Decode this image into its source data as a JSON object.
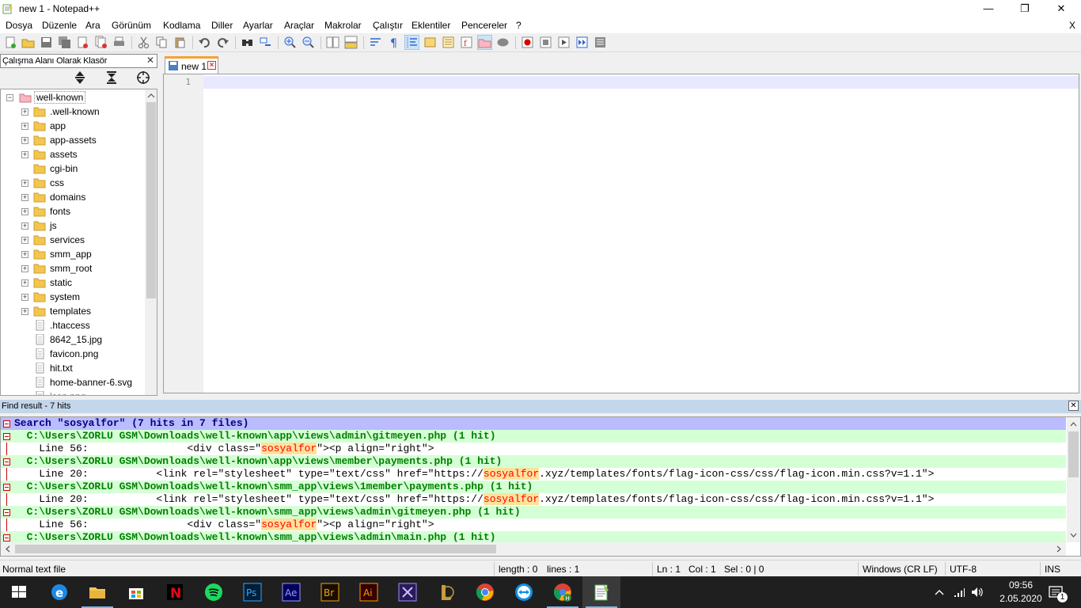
{
  "window": {
    "title": "new 1 - Notepad++",
    "minimize": "—",
    "restore": "❐",
    "close": "✕"
  },
  "menu": [
    {
      "label": "Dosya"
    },
    {
      "label": "Düzenle"
    },
    {
      "label": "Ara"
    },
    {
      "label": "Görünüm"
    },
    {
      "label": "Kodlama"
    },
    {
      "label": "Diller"
    },
    {
      "label": "Ayarlar"
    },
    {
      "label": "Araçlar"
    },
    {
      "label": "Makrolar"
    },
    {
      "label": "Çalıştır"
    },
    {
      "label": "Eklentiler"
    },
    {
      "label": "Pencereler"
    },
    {
      "label": "?"
    }
  ],
  "menu_close": "X",
  "workspace": {
    "title": "Çalışma Alanı Olarak Klasör",
    "close": "✕",
    "root": "well-known",
    "items": [
      {
        "label": ".well-known",
        "type": "folder",
        "expandable": true
      },
      {
        "label": "app",
        "type": "folder",
        "expandable": true
      },
      {
        "label": "app-assets",
        "type": "folder",
        "expandable": true
      },
      {
        "label": "assets",
        "type": "folder",
        "expandable": true
      },
      {
        "label": "cgi-bin",
        "type": "folder",
        "expandable": false
      },
      {
        "label": "css",
        "type": "folder",
        "expandable": true
      },
      {
        "label": "domains",
        "type": "folder",
        "expandable": true
      },
      {
        "label": "fonts",
        "type": "folder",
        "expandable": true
      },
      {
        "label": "js",
        "type": "folder",
        "expandable": true
      },
      {
        "label": "services",
        "type": "folder",
        "expandable": true
      },
      {
        "label": "smm_app",
        "type": "folder",
        "expandable": true
      },
      {
        "label": "smm_root",
        "type": "folder",
        "expandable": true
      },
      {
        "label": "static",
        "type": "folder",
        "expandable": true
      },
      {
        "label": "system",
        "type": "folder",
        "expandable": true
      },
      {
        "label": "templates",
        "type": "folder",
        "expandable": true
      },
      {
        "label": ".htaccess",
        "type": "file",
        "expandable": false
      },
      {
        "label": "8642_15.jpg",
        "type": "file",
        "expandable": false
      },
      {
        "label": "favicon.png",
        "type": "file",
        "expandable": false
      },
      {
        "label": "hit.txt",
        "type": "file",
        "expandable": false
      },
      {
        "label": "home-banner-6.svg",
        "type": "file",
        "expandable": false
      },
      {
        "label": "icon.png",
        "type": "file",
        "expandable": false
      }
    ]
  },
  "editor": {
    "tab_label": "new 1",
    "line_number": "1"
  },
  "find": {
    "header": "Find result - 7 hits",
    "close": "✕",
    "lines": [
      {
        "kind": "search",
        "text": "Search \"sosyalfor\" (7 hits in 7 files)"
      },
      {
        "kind": "file",
        "text": "  C:\\Users\\ZORLU GSM\\Downloads\\well-known\\app\\views\\admin\\gitmeyen.php (1 hit)"
      },
      {
        "kind": "hit",
        "pre": "    Line 56:                <div class=\"",
        "match": "sosyalfor",
        "post": "\"><p align=\"right\">"
      },
      {
        "kind": "file",
        "text": "  C:\\Users\\ZORLU GSM\\Downloads\\well-known\\app\\views\\member\\payments.php (1 hit)"
      },
      {
        "kind": "hit",
        "pre": "    Line 20:           <link rel=\"stylesheet\" type=\"text/css\" href=\"https://",
        "match": "sosyalfor",
        "post": ".xyz/templates/fonts/flag-icon-css/css/flag-icon.min.css?v=1.1\">"
      },
      {
        "kind": "file",
        "text": "  C:\\Users\\ZORLU GSM\\Downloads\\well-known\\smm_app\\views\\1member\\payments.php (1 hit)"
      },
      {
        "kind": "hit",
        "pre": "    Line 20:           <link rel=\"stylesheet\" type=\"text/css\" href=\"https://",
        "match": "sosyalfor",
        "post": ".xyz/templates/fonts/flag-icon-css/css/flag-icon.min.css?v=1.1\">"
      },
      {
        "kind": "file",
        "text": "  C:\\Users\\ZORLU GSM\\Downloads\\well-known\\smm_app\\views\\admin\\gitmeyen.php (1 hit)"
      },
      {
        "kind": "hit",
        "pre": "    Line 56:                <div class=\"",
        "match": "sosyalfor",
        "post": "\"><p align=\"right\">"
      },
      {
        "kind": "file",
        "text": "  C:\\Users\\ZORLU GSM\\Downloads\\well-known\\smm_app\\views\\admin\\main.php (1 hit)"
      }
    ]
  },
  "status": {
    "filetype": "Normal text file",
    "length": "length : 0",
    "lines": "lines : 1",
    "ln": "Ln : 1",
    "col": "Col : 1",
    "sel": "Sel : 0 | 0",
    "eol": "Windows (CR LF)",
    "encoding": "UTF-8",
    "mode": "INS"
  },
  "taskbar": {
    "time": "09:56",
    "date": "2.05.2020",
    "notification_count": "1",
    "apps": [
      "start",
      "edge",
      "file-explorer",
      "store",
      "netflix",
      "spotify",
      "photoshop",
      "after-effects",
      "bridge",
      "illustrator",
      "premiere-like",
      "league",
      "chrome",
      "teamviewer",
      "chrome-profile",
      "notepad-plus-plus"
    ]
  },
  "colors": {
    "accent_tab": "#f8a032",
    "find_file_bg": "#d5ffd5",
    "find_file_fg": "#008000",
    "find_search_bg": "#bbbbff",
    "find_match": "#ff0000"
  }
}
